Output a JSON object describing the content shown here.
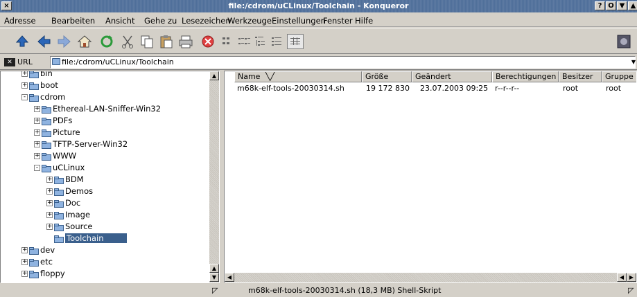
{
  "window": {
    "title": "file:/cdrom/uCLinux/Toolchain - Konqueror",
    "buttons": [
      "?",
      "O",
      "▼",
      "▲"
    ]
  },
  "menu": [
    "Adresse",
    "Bearbeiten",
    "Ansicht",
    "Gehe zu",
    "Lesezeichen",
    "Werkzeuge",
    "Einstellungen",
    "Fenster",
    "Hilfe"
  ],
  "toolbar": {
    "icons": [
      "up-arrow-icon",
      "back-arrow-icon",
      "forward-arrow-icon",
      "home-icon",
      "reload-icon",
      "cut-icon",
      "copy-icon",
      "paste-icon",
      "print-icon",
      "stop-icon",
      "icon-view-icon",
      "multicolumn-view-icon",
      "tree-view-icon",
      "info-list-view-icon",
      "detailed-list-view-icon"
    ]
  },
  "location": {
    "url_label": "URL",
    "url_value": "file:/cdrom/uCLinux/Toolchain"
  },
  "tree": [
    {
      "label": "bin",
      "level": 1,
      "expander": "+"
    },
    {
      "label": "boot",
      "level": 1,
      "expander": "+"
    },
    {
      "label": "cdrom",
      "level": 1,
      "expander": "-"
    },
    {
      "label": "Ethereal-LAN-Sniffer-Win32",
      "level": 2,
      "expander": "+"
    },
    {
      "label": "PDFs",
      "level": 2,
      "expander": "+"
    },
    {
      "label": "Picture",
      "level": 2,
      "expander": "+"
    },
    {
      "label": "TFTP-Server-Win32",
      "level": 2,
      "expander": "+"
    },
    {
      "label": "WWW",
      "level": 2,
      "expander": "+"
    },
    {
      "label": "uCLinux",
      "level": 2,
      "expander": "-"
    },
    {
      "label": "BDM",
      "level": 3,
      "expander": "+"
    },
    {
      "label": "Demos",
      "level": 3,
      "expander": "+"
    },
    {
      "label": "Doc",
      "level": 3,
      "expander": "+"
    },
    {
      "label": "Image",
      "level": 3,
      "expander": "+"
    },
    {
      "label": "Source",
      "level": 3,
      "expander": "+"
    },
    {
      "label": "Toolchain",
      "level": 3,
      "expander": "",
      "selected": true
    },
    {
      "label": "dev",
      "level": 1,
      "expander": "+"
    },
    {
      "label": "etc",
      "level": 1,
      "expander": "+"
    },
    {
      "label": "floppy",
      "level": 1,
      "expander": "+"
    }
  ],
  "filelist": {
    "columns": [
      "Name",
      "Größe",
      "Geändert",
      "Berechtigungen",
      "Besitzer",
      "Gruppe"
    ],
    "rows": [
      [
        "m68k-elf-tools-20030314.sh",
        "19 172 830",
        "23.07.2003 09:25",
        "r--r--r--",
        "root",
        "root"
      ]
    ]
  },
  "status": {
    "text": "m68k-elf-tools-20030314.sh (18,3 MB)  Shell-Skript"
  },
  "colors": {
    "titlebar": "#4f6f9a",
    "selection": "#3a5f8c",
    "chrome": "#d4d0c8"
  }
}
